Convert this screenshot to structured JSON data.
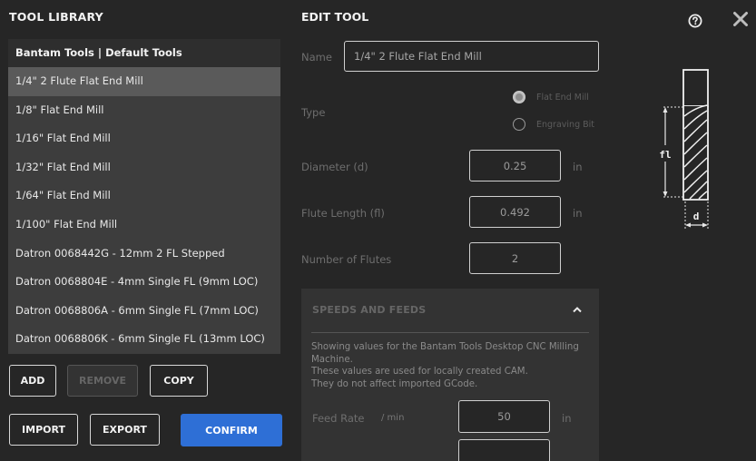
{
  "library": {
    "title": "TOOL LIBRARY",
    "header": "Bantam Tools | Default Tools",
    "items": [
      "1/4\" 2 Flute Flat End Mill",
      "1/8\" Flat End Mill",
      "1/16\" Flat End Mill",
      "1/32\" Flat End Mill",
      "1/64\" Flat End Mill",
      "1/100\" Flat End Mill",
      "Datron 0068442G - 12mm 2 FL Stepped",
      "Datron 0068804E - 4mm Single FL (9mm LOC)",
      "Datron 0068806A - 6mm Single FL (7mm LOC)",
      "Datron 0068806K - 6mm Single FL (13mm LOC)"
    ],
    "selected_index": 0
  },
  "actions": {
    "add": "ADD",
    "remove": "REMOVE",
    "copy": "COPY",
    "import": "IMPORT",
    "export": "EXPORT",
    "confirm": "CONFIRM"
  },
  "edit": {
    "title": "EDIT TOOL",
    "name_label": "Name",
    "name_value": "1/4\" 2 Flute Flat End Mill",
    "type_label": "Type",
    "type_options": [
      "Flat End Mill",
      "Engraving Bit"
    ],
    "type_selected": 0,
    "diameter_label": "Diameter (d)",
    "diameter_value": "0.25",
    "diameter_unit": "in",
    "flute_length_label": "Flute Length (fl)",
    "flute_length_value": "0.492",
    "flute_length_unit": "in",
    "flutes_label": "Number of Flutes",
    "flutes_value": "2"
  },
  "speeds": {
    "title": "SPEEDS AND FEEDS",
    "desc_1": "Showing values for the Bantam Tools Desktop CNC Milling Machine.",
    "desc_2": "These values are used for locally created CAM.",
    "desc_3": "They do not affect imported GCode.",
    "feed_label": "Feed Rate",
    "feed_per": "/ min",
    "feed_value": "50",
    "feed_unit": "in"
  },
  "diagram": {
    "fl_label": "fl",
    "d_label": "d"
  },
  "icons": {
    "help": "help-icon",
    "close": "close-icon",
    "collapse": "chevron-up-icon"
  },
  "colors": {
    "accent": "#2e6fd6",
    "background": "#262626",
    "list_bg": "#3d3d3d",
    "selected_bg": "#5a5a5a"
  }
}
